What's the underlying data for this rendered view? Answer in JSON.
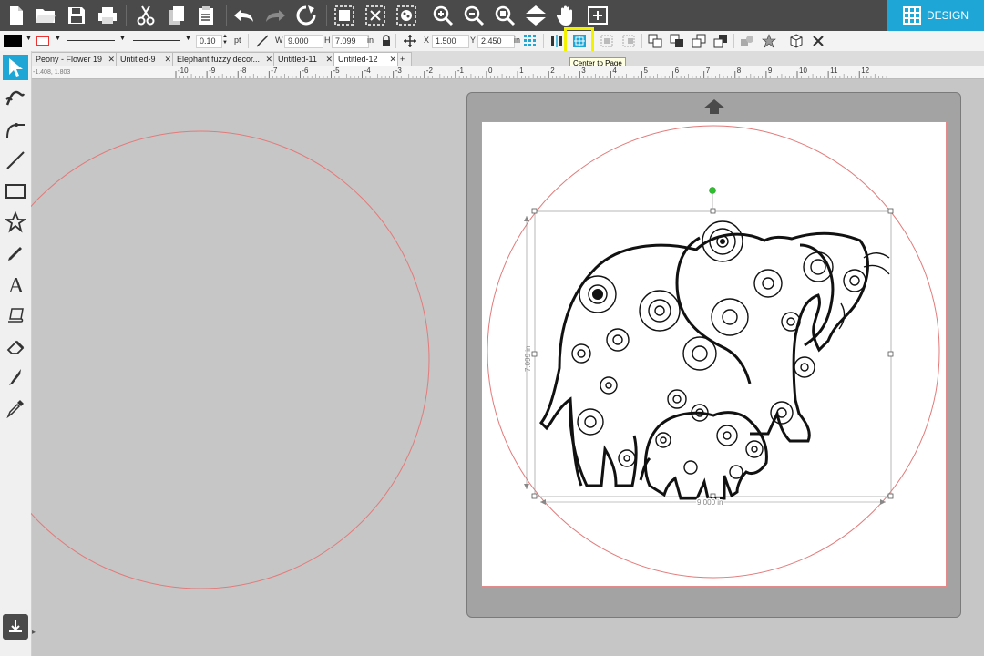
{
  "toolbar": {
    "design_label": "DESIGN",
    "accent_color": "#1ea7d6"
  },
  "properties": {
    "line_weight": "0.10",
    "line_unit": "pt",
    "width_label": "W",
    "width": "9.000",
    "height_label": "H",
    "height": "7.099",
    "size_unit": "in",
    "x_label": "X",
    "x": "1.500",
    "y_label": "Y",
    "y": "2.450",
    "pos_unit": "in"
  },
  "tooltip": "Center to Page",
  "tabs": [
    {
      "label": "Peony - Flower 19"
    },
    {
      "label": "Untitled-9"
    },
    {
      "label": "Elephant fuzzy decor..."
    },
    {
      "label": "Untitled-11"
    },
    {
      "label": "Untitled-12"
    }
  ],
  "ruler": {
    "labels": [
      "-10",
      "-9",
      "-8",
      "-7",
      "-6",
      "-5",
      "-4",
      "-3",
      "-2",
      "-1",
      "0",
      "1",
      "2",
      "3",
      "4",
      "5",
      "6",
      "7",
      "8",
      "9",
      "10",
      "11",
      "12"
    ],
    "cursor_readout": "-1.408, 1.803"
  },
  "selection": {
    "height_dim": "7.099 in",
    "width_dim": "9.000 in"
  },
  "colors": {
    "cut_line": "#e37a7a",
    "mat": "#a3a3a3",
    "canvas": "#c6c6c6",
    "highlight": "#f2f200"
  }
}
